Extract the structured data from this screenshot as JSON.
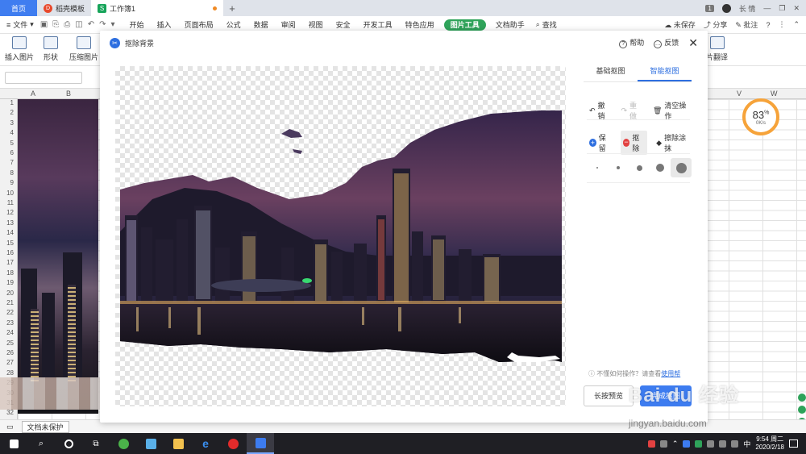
{
  "tabs": {
    "home": "首页",
    "template": "稻壳模板",
    "doc": "工作簿1",
    "doc_badge": "S",
    "template_badge": "D",
    "new_tab": "+",
    "right_count": "1",
    "user": "长 情"
  },
  "menu": {
    "file": "文件",
    "items": [
      "开始",
      "插入",
      "页面布局",
      "公式",
      "数据",
      "审阅",
      "视图",
      "安全",
      "开发工具",
      "特色应用",
      "图片工具",
      "文档助手"
    ],
    "active": "图片工具",
    "search": "查找",
    "right": [
      "未保存",
      "分享",
      "批注"
    ]
  },
  "ribbon": {
    "left": [
      "插入图片",
      "形状",
      "压缩图片"
    ],
    "right": "片翻译"
  },
  "sheet": {
    "columns": [
      "A",
      "B",
      "V",
      "W"
    ],
    "rows": [
      "1",
      "2",
      "3",
      "4",
      "5",
      "6",
      "7",
      "8",
      "9",
      "10",
      "11",
      "12",
      "13",
      "14",
      "15",
      "16",
      "17",
      "18",
      "19",
      "20",
      "21",
      "22",
      "23",
      "24",
      "25",
      "26",
      "27",
      "28",
      "29",
      "30",
      "31",
      "32"
    ],
    "bottom_tab": "文档未保护",
    "speed_value": "83",
    "speed_unit": "%",
    "speed_rate": "0K/s"
  },
  "dialog": {
    "title": "抠除背景",
    "help": "帮助",
    "feedback": "反馈",
    "panel_tabs": [
      "基础抠图",
      "智能抠图"
    ],
    "active_tab": "智能抠图",
    "undo": "撤销",
    "redo": "重做",
    "clear": "清空操作",
    "keep": "保留",
    "remove": "抠除",
    "erase": "擦除涂抹",
    "help_text": "不懂如何操作？请查看",
    "help_link": "使用帮",
    "preview_button": "长按预览",
    "done_button": "完成抠图"
  },
  "watermark": {
    "brand": "Bai du 经验",
    "url": "jingyan.baidu.com"
  },
  "taskbar": {
    "time": "9:54 周二",
    "date": "2020/2/18",
    "ime": "中"
  },
  "colors": {
    "accent": "#3d7cf0",
    "tool_tab": "#2fa35a",
    "remove": "#e24141"
  }
}
